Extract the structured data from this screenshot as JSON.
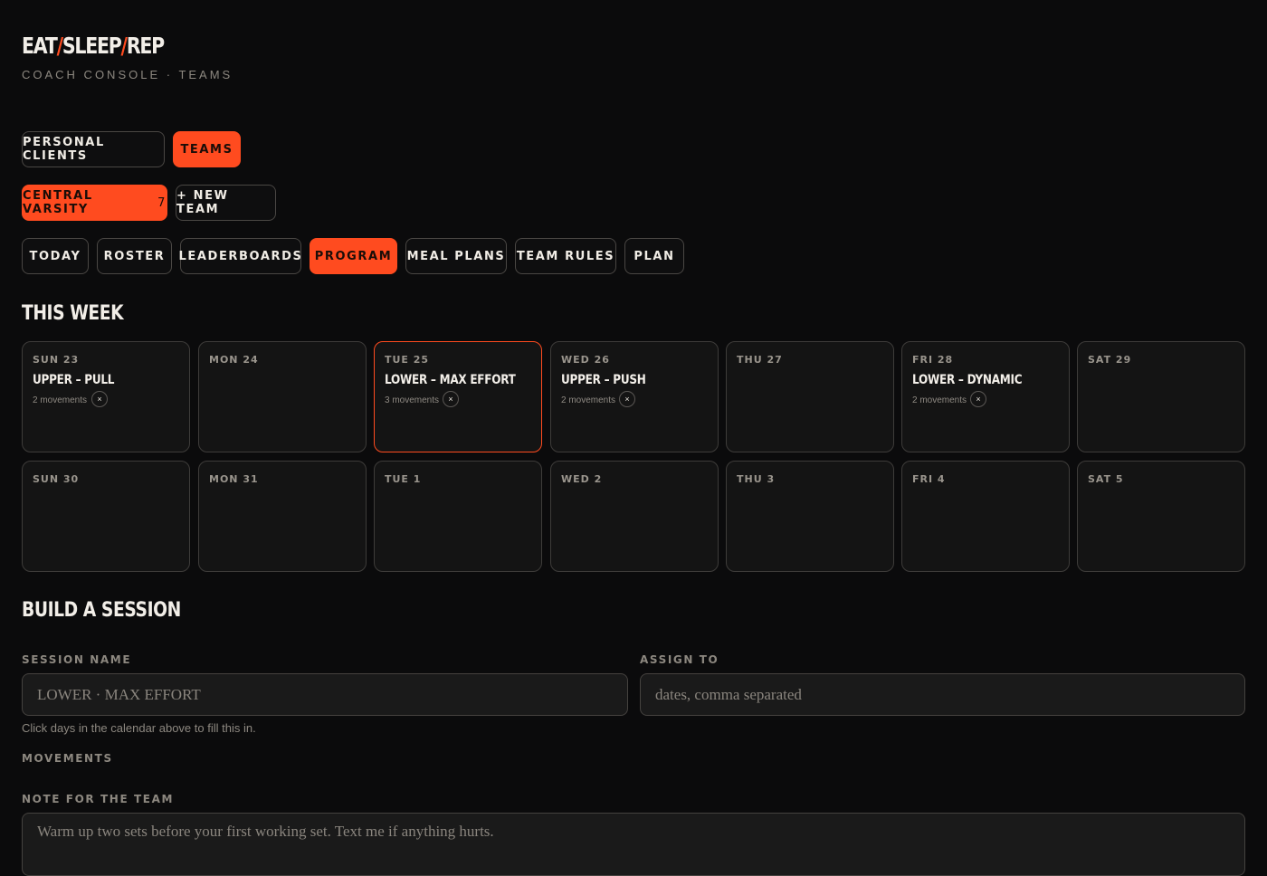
{
  "brand": {
    "logo_parts": [
      "EAT",
      "/",
      "SLEEP",
      "/",
      "REP"
    ],
    "subtitle": "COACH CONSOLE · TEAMS"
  },
  "mode_tabs": [
    {
      "label": "PERSONAL CLIENTS",
      "active": false
    },
    {
      "label": "TEAMS",
      "active": true
    }
  ],
  "teams": [
    {
      "label": "CENTRAL VARSITY",
      "count": "7",
      "active": true
    },
    {
      "label": "+ NEW TEAM",
      "active": false
    }
  ],
  "section_tabs": [
    {
      "label": "TODAY",
      "active": false
    },
    {
      "label": "ROSTER",
      "active": false
    },
    {
      "label": "LEADERBOARDS",
      "active": false
    },
    {
      "label": "PROGRAM",
      "active": true
    },
    {
      "label": "MEAL PLANS",
      "active": false
    },
    {
      "label": "TEAM RULES",
      "active": false
    },
    {
      "label": "PLAN",
      "active": false
    }
  ],
  "calendar": {
    "title": "THIS WEEK",
    "weeks": [
      [
        {
          "date": "SUN 23",
          "session": "UPPER – PULL",
          "movements": "2 movements",
          "selected": false
        },
        {
          "date": "MON 24"
        },
        {
          "date": "TUE 25",
          "session": "LOWER – MAX EFFORT",
          "movements": "3 movements",
          "selected": true
        },
        {
          "date": "WED 26",
          "session": "UPPER – PUSH",
          "movements": "2 movements",
          "selected": false
        },
        {
          "date": "THU 27"
        },
        {
          "date": "FRI 28",
          "session": "LOWER – DYNAMIC",
          "movements": "2 movements",
          "selected": false
        },
        {
          "date": "SAT 29"
        }
      ],
      [
        {
          "date": "SUN 30"
        },
        {
          "date": "MON 31"
        },
        {
          "date": "TUE 1"
        },
        {
          "date": "WED 2"
        },
        {
          "date": "THU 3"
        },
        {
          "date": "FRI 4"
        },
        {
          "date": "SAT 5"
        }
      ]
    ],
    "remove_glyph": "×"
  },
  "builder": {
    "title": "BUILD A SESSION",
    "session_name_label": "SESSION NAME",
    "session_name_placeholder": "LOWER · MAX EFFORT",
    "assign_label": "ASSIGN TO",
    "assign_placeholder": "dates, comma separated",
    "hint": "Click days in the calendar above to fill this in.",
    "movements_label": "MOVEMENTS",
    "note_label": "NOTE FOR THE TEAM",
    "note_placeholder": "Warm up two sets before your first working set. Text me if anything hurts."
  },
  "colors": {
    "accent": "#ff4b1f",
    "background": "#0b0b0c",
    "card": "#141414"
  }
}
